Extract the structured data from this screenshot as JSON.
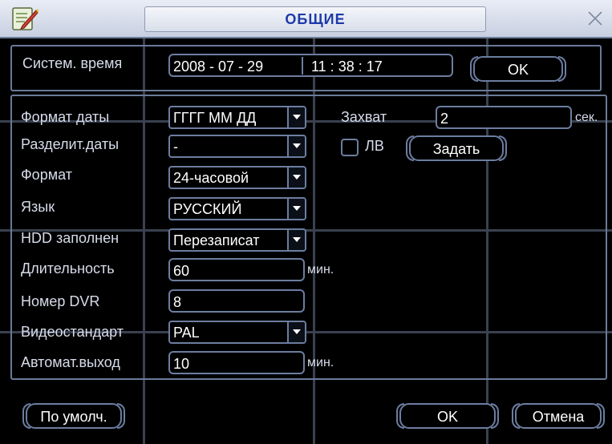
{
  "window": {
    "title": "ОБЩИЕ",
    "icons": {
      "app": "settings-pencil-icon",
      "close": "close-icon"
    }
  },
  "system_time": {
    "label": "Систем. время",
    "date": "2008  - 07 - 29",
    "time": "11 : 38 : 17",
    "ok_label": "OK"
  },
  "settings": {
    "date_format": {
      "label": "Формат даты",
      "value": "ГГГГ ММ ДД"
    },
    "date_separator": {
      "label": "Разделит.даты",
      "value": "-"
    },
    "time_format": {
      "label": "Формат",
      "value": "24-часовой"
    },
    "language": {
      "label": "Язык",
      "value": "РУССКИЙ"
    },
    "hdd_full": {
      "label": "HDD заполнен",
      "value": "Перезаписат"
    },
    "duration": {
      "label": "Длительность",
      "value": "60",
      "unit": "мин."
    },
    "dvr_number": {
      "label": "Номер DVR",
      "value": "8"
    },
    "video_standard": {
      "label": "Видеостандарт",
      "value": "PAL"
    },
    "auto_logout": {
      "label": "Автомат.выход",
      "value": "10",
      "unit": "мин."
    }
  },
  "capture": {
    "label": "Захват",
    "value": "2",
    "unit": "сек.",
    "lv_label": "ЛВ",
    "lv_checked": false,
    "set_label": "Задать"
  },
  "footer": {
    "default_label": "По умолч.",
    "ok_label": "OK",
    "cancel_label": "Отмена"
  },
  "colors": {
    "title_text": "#1e3aa8",
    "border": "#6c7da0",
    "background": "#000000"
  }
}
